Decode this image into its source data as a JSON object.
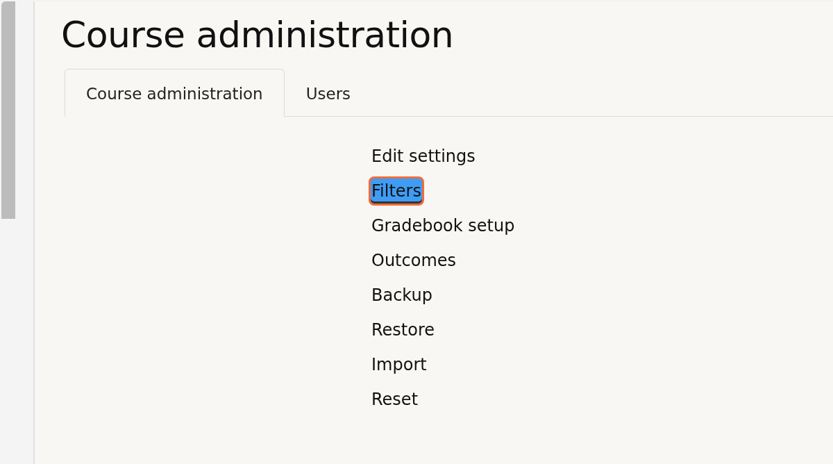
{
  "page_title": "Course administration",
  "tabs": [
    {
      "label": "Course administration",
      "selected": true
    },
    {
      "label": "Users",
      "selected": false
    }
  ],
  "links": [
    {
      "label": "Edit settings",
      "selected": false
    },
    {
      "label": "Filters",
      "selected": true
    },
    {
      "label": "Gradebook setup",
      "selected": false
    },
    {
      "label": "Outcomes",
      "selected": false
    },
    {
      "label": "Backup",
      "selected": false
    },
    {
      "label": "Restore",
      "selected": false
    },
    {
      "label": "Import",
      "selected": false
    },
    {
      "label": "Reset",
      "selected": false
    }
  ]
}
